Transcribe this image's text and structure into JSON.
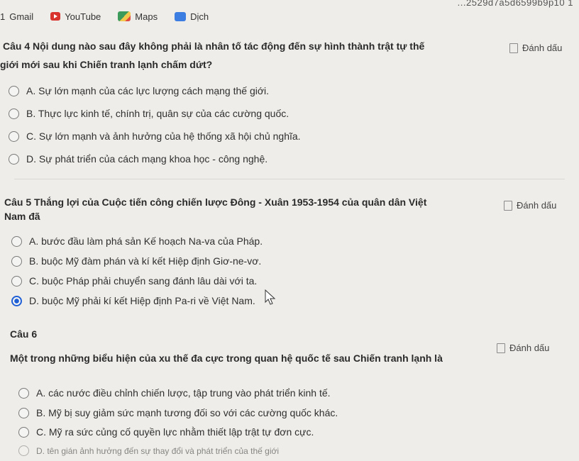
{
  "address": {
    "fragment": "...2529d7a5d6599b9p10 1"
  },
  "bookmarks": [
    {
      "label": "Gmail",
      "icon": "gmail-icon"
    },
    {
      "label": "YouTube",
      "icon": "youtube-icon"
    },
    {
      "label": "Maps",
      "icon": "maps-icon"
    },
    {
      "label": "Dịch",
      "icon": "translate-icon"
    }
  ],
  "colors": {
    "selected": "#1f5fd6",
    "background": "#eeede9"
  },
  "q4": {
    "title_line1": "Câu 4  Nội dung nào sau đây không phải là nhân tố tác động đến sự hình thành trật tự thế",
    "title_line2": "giới mới sau khi Chiến tranh lạnh chấm dứt?",
    "flag": "Đánh dấu",
    "options": [
      "A. Sự lớn mạnh của các lực lượng cách mạng thế giới.",
      "B. Thực lực kinh tế, chính trị, quân sự của các cường quốc.",
      "C. Sự lớn mạnh và ảnh hưởng của hệ thống xã hội chủ nghĩa.",
      "D. Sự phát triển của cách mạng khoa học - công nghệ."
    ]
  },
  "q5": {
    "title_line1": "Câu 5  Thắng lợi của Cuộc tiến công chiến lược Đông - Xuân 1953-1954 của quân dân Việt",
    "title_line2": "Nam đã",
    "flag": "Đánh dấu",
    "options": [
      "A. bước đầu làm phá sản Kế hoạch Na-va của Pháp.",
      "B. buộc Mỹ đàm phán và kí kết Hiệp định Giơ-ne-vơ.",
      "C. buộc Pháp phải chuyển sang đánh lâu dài với ta.",
      "D. buộc Mỹ phải kí kết Hiệp định Pa-ri về Việt Nam."
    ],
    "selected": 3
  },
  "q6": {
    "number": "Câu 6",
    "title": "Một trong những biểu hiện của xu thế đa cực trong quan hệ quốc tế sau Chiến tranh lạnh là",
    "flag": "Đánh dấu",
    "options": [
      "A. các nước điều chỉnh chiến lược, tập trung vào phát triển kinh tế.",
      "B. Mỹ bị suy giảm sức mạnh tương đối so với các cường quốc khác.",
      "C. Mỹ ra sức củng cố quyền lực nhằm thiết lập trật tự đơn cực.",
      "D. tên gián ảnh hưởng đến sự thay đổi và phát triển của thế giới"
    ]
  }
}
